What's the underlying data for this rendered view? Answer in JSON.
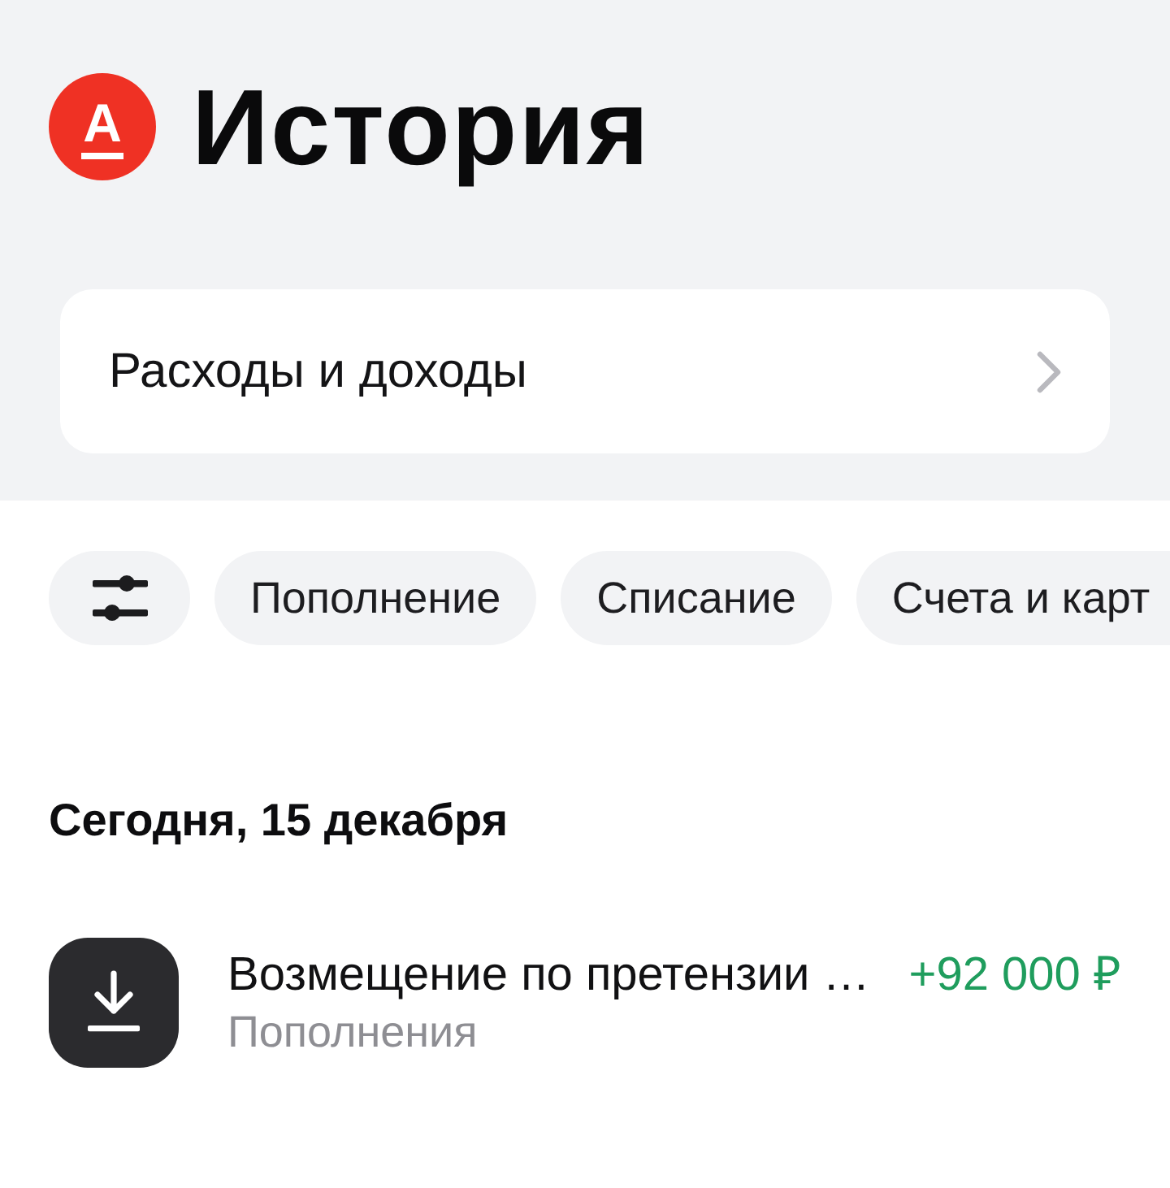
{
  "header": {
    "logo_mark": "А",
    "title": "История"
  },
  "summary_link": {
    "label": "Расходы и доходы"
  },
  "chips": [
    {
      "label": "Пополнение",
      "selected": false
    },
    {
      "label": "Списание",
      "selected": false
    },
    {
      "label": "Счета и карт",
      "selected": false
    }
  ],
  "sections": [
    {
      "heading": "Сегодня, 15 декабря",
      "operations": [
        {
          "kind": "income",
          "title": "Возмещение по претензии …",
          "category": "Пополнения",
          "amount": "+92 000 ₽"
        }
      ]
    }
  ]
}
